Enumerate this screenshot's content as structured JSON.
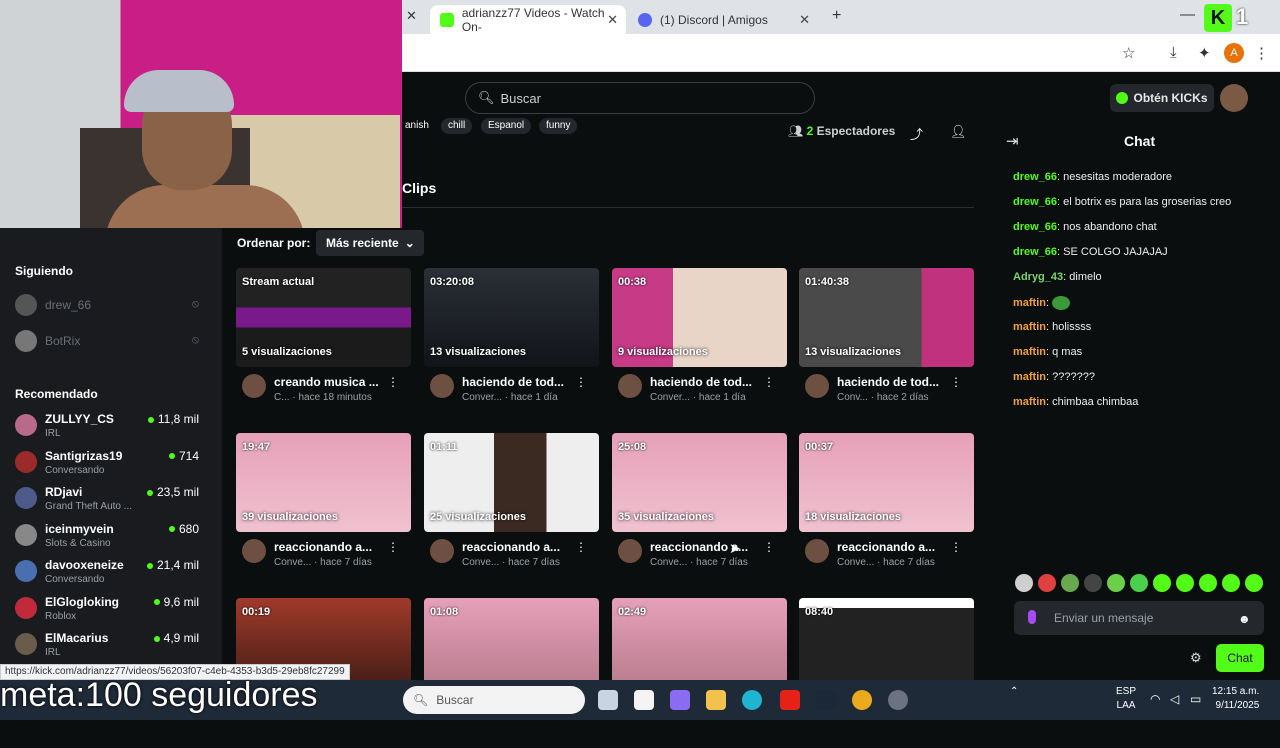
{
  "browser": {
    "tabs": [
      {
        "title": "adrianzz77 Videos - Watch On-"
      },
      {
        "title": "(1) Discord | Amigos"
      }
    ],
    "new_tab": "+",
    "profile_initial": "A"
  },
  "brand": {
    "logo": "K",
    "badge_count": "1",
    "accent": "#53fc18"
  },
  "search": {
    "placeholder": "Buscar"
  },
  "header": {
    "obtain_label": "Obtén KICKs"
  },
  "tags": [
    "anish",
    "chill",
    "Espanol",
    "funny"
  ],
  "viewers": {
    "count": "2",
    "label": "Espectadores"
  },
  "section_title": "Clips",
  "sort": {
    "label": "Ordenar por:",
    "value": "Más reciente"
  },
  "sidebar": {
    "following_title": "Siguiendo",
    "following": [
      {
        "name": "drew_66"
      },
      {
        "name": "BotRix"
      }
    ],
    "recommended_title": "Recomendado",
    "recommended": [
      {
        "name": "ZULLYY_CS",
        "category": "IRL",
        "viewers": "11,8 mil"
      },
      {
        "name": "Santigrizas19",
        "category": "Conversando",
        "viewers": "714"
      },
      {
        "name": "RDjavi",
        "category": "Grand Theft Auto ...",
        "viewers": "23,5 mil"
      },
      {
        "name": "iceinmyvein",
        "category": "Slots & Casino",
        "viewers": "680"
      },
      {
        "name": "davooxeneize",
        "category": "Conversando",
        "viewers": "21,4 mil"
      },
      {
        "name": "ElGlogloking",
        "category": "Roblox",
        "viewers": "9,6 mil"
      },
      {
        "name": "ElMacarius",
        "category": "IRL",
        "viewers": "4,9 mil"
      }
    ]
  },
  "clips": [
    {
      "duration": "Stream actual",
      "views": "5 visualizaciones",
      "title": "creando musica ...",
      "category": "C...",
      "age": "hace 18 minutos"
    },
    {
      "duration": "03:20:08",
      "views": "13 visualizaciones",
      "title": "haciendo de tod...",
      "category": "Conver...",
      "age": "hace 1 día"
    },
    {
      "duration": "00:38",
      "views": "9 visualizaciones",
      "title": "haciendo de tod...",
      "category": "Conver...",
      "age": "hace 1 día"
    },
    {
      "duration": "01:40:38",
      "views": "13 visualizaciones",
      "title": "haciendo de tod...",
      "category": "Conv...",
      "age": "hace 2 días"
    },
    {
      "duration": "19:47",
      "views": "39 visualizaciones",
      "title": "reaccionando a...",
      "category": "Conve...",
      "age": "hace 7 días"
    },
    {
      "duration": "01:11",
      "views": "25 visualizaciones",
      "title": "reaccionando a...",
      "category": "Conve...",
      "age": "hace 7 días"
    },
    {
      "duration": "25:08",
      "views": "35 visualizaciones",
      "title": "reaccionando a...",
      "category": "Conve...",
      "age": "hace 7 días"
    },
    {
      "duration": "00:37",
      "views": "18 visualizaciones",
      "title": "reaccionando a...",
      "category": "Conve...",
      "age": "hace 7 días"
    },
    {
      "duration": "00:19",
      "views": "",
      "title": "",
      "category": "",
      "age": ""
    },
    {
      "duration": "01:08",
      "views": "",
      "title": "",
      "category": "",
      "age": ""
    },
    {
      "duration": "02:49",
      "views": "",
      "title": "",
      "category": "",
      "age": ""
    },
    {
      "duration": "08:40",
      "views": "",
      "title": "",
      "category": "",
      "age": ""
    }
  ],
  "chat": {
    "title": "Chat",
    "messages": [
      {
        "user": "drew_66",
        "text": "nesesitas moderadore",
        "color": "#53fc18"
      },
      {
        "user": "drew_66",
        "text": "el botrix es para las groserias creo",
        "color": "#53fc18"
      },
      {
        "user": "drew_66",
        "text": "nos abandono chat",
        "color": "#53fc18"
      },
      {
        "user": "drew_66",
        "text": "SE COLGO JAJAJAJ",
        "color": "#53fc18"
      },
      {
        "user": "Adryg_43",
        "text": "dimelo",
        "color": "#7cd46b"
      },
      {
        "user": "maftin",
        "text": "",
        "color": "#f0a13a"
      },
      {
        "user": "maftin",
        "text": "holissss",
        "color": "#f0a13a"
      },
      {
        "user": "maftin",
        "text": "q mas",
        "color": "#f0a13a"
      },
      {
        "user": "maftin",
        "text": "???????",
        "color": "#f0a13a"
      },
      {
        "user": "maftin",
        "text": "chimbaa chimbaa",
        "color": "#f0a13a"
      }
    ],
    "input_placeholder": "Enviar un mensaje",
    "send_label": "Chat"
  },
  "status_url": "https://kick.com/adrianzz77/videos/56203f07-c4eb-4353-b3d5-29eb8fc27299",
  "overlay_text": "meta:100 seguidores",
  "taskbar": {
    "search_placeholder": "Buscar",
    "lang_top": "ESP",
    "lang_bottom": "LAA",
    "time": "12:15 a.m.",
    "date": "9/11/2025"
  }
}
